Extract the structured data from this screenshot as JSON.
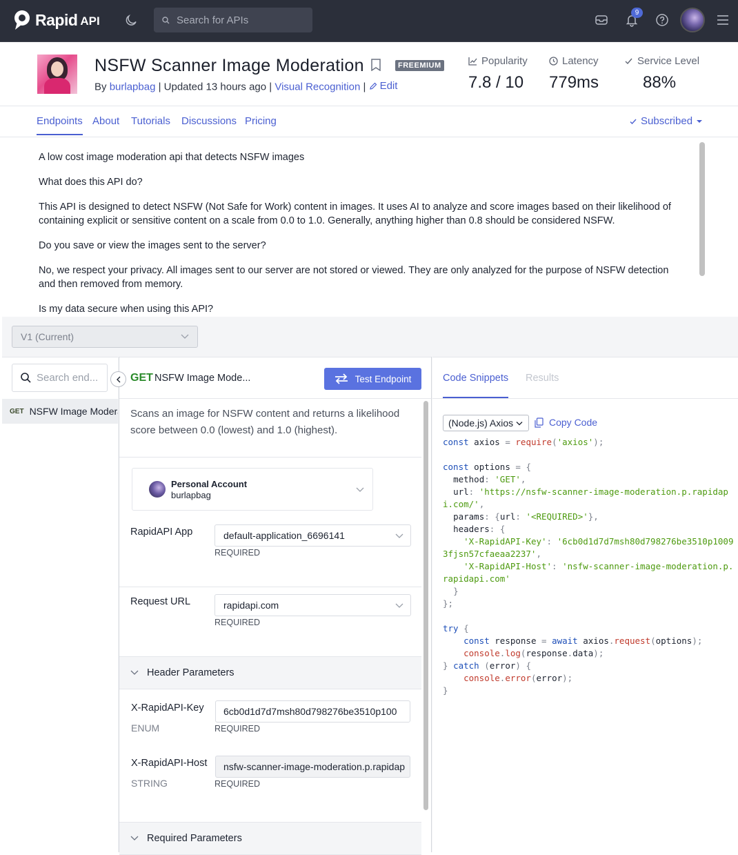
{
  "topbar": {
    "brand": "Rapid",
    "brand_suffix": "API",
    "search_placeholder": "Search for APIs",
    "notification_count": "9",
    "icons": [
      "moon-icon",
      "search-icon",
      "inbox-icon",
      "bell-icon",
      "help-icon",
      "menu-icon"
    ]
  },
  "api": {
    "title": "NSFW Scanner Image Moderation",
    "plan_badge": "FREEMIUM",
    "by_label": "By",
    "author": "burlapbag",
    "updated": "Updated 13 hours ago",
    "category": "Visual Recognition",
    "edit_label": "Edit",
    "stats": [
      {
        "label": "Popularity",
        "value": "7.8 / 10",
        "icon": "chart-icon"
      },
      {
        "label": "Latency",
        "value": "779ms",
        "icon": "clock-icon"
      },
      {
        "label": "Service Level",
        "value": "88%",
        "icon": "check-icon"
      }
    ]
  },
  "tabs": [
    "Endpoints",
    "About",
    "Tutorials",
    "Discussions",
    "Pricing"
  ],
  "subscription": "Subscribed",
  "about": [
    "A low cost image moderation api that detects NSFW images",
    "What does this API do?",
    "This API is designed to detect NSFW (Not Safe for Work) content in images. It uses AI to analyze and score images based on their likelihood of containing explicit or sensitive content on a scale from 0.0 to 1.0. Generally, anything higher than 0.8 should be considered NSFW.",
    "Do you save or view the images sent to the server?",
    "No, we respect your privacy. All images sent to our server are not stored or viewed. They are only analyzed for the purpose of NSFW detection and then removed from memory.",
    "Is my data secure when using this API?"
  ],
  "version": "V1 (Current)",
  "endpoints": {
    "search_placeholder": "Search end...",
    "items": [
      {
        "method": "GET",
        "name": "NSFW Image Moderation"
      }
    ]
  },
  "endpoint": {
    "method": "GET",
    "title": "NSFW Image Mode...",
    "test_button": "Test Endpoint",
    "description": "Scans an image for NSFW content and returns a likelihood score between 0.0 (lowest) and 1.0 (highest).",
    "account": {
      "name": "Personal Account",
      "user": "burlapbag"
    },
    "app": {
      "label": "RapidAPI App",
      "value": "default-application_6696141",
      "note": "REQUIRED"
    },
    "request_url": {
      "label": "Request URL",
      "value": "rapidapi.com",
      "note": "REQUIRED"
    },
    "header_section": "Header Parameters",
    "headers": [
      {
        "name": "X-RapidAPI-Key",
        "type": "ENUM",
        "value": "6cb0d1d7d7msh80d798276be3510p100",
        "note": "REQUIRED"
      },
      {
        "name": "X-RapidAPI-Host",
        "type": "STRING",
        "value": "nsfw-scanner-image-moderation.p.rapidap",
        "note": "REQUIRED"
      }
    ],
    "required_section": "Required Parameters"
  },
  "snippets": {
    "tabs": [
      "Code Snippets",
      "Results"
    ],
    "language": "(Node.js) Axios",
    "copy_label": "Copy Code"
  }
}
